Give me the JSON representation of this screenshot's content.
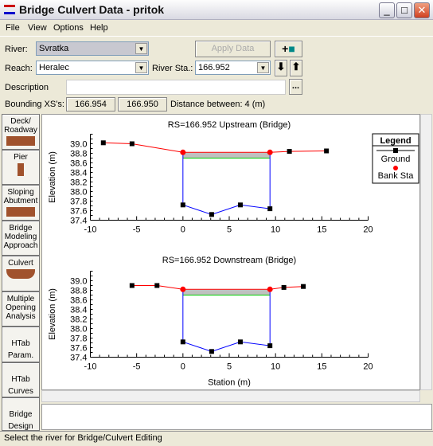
{
  "window": {
    "title": "Bridge Culvert Data - pritok",
    "icon": "bridge-icon"
  },
  "menu": [
    "File",
    "View",
    "Options",
    "Help"
  ],
  "form": {
    "river_label": "River:",
    "river_value": "Svratka",
    "reach_label": "Reach:",
    "reach_value": "Heralec",
    "river_sta_label": "River Sta.:",
    "river_sta_value": "166.952",
    "apply_label": "Apply Data",
    "description_label": "Description",
    "description_value": "",
    "more_label": "...",
    "bounding_label": "Bounding XS's:",
    "bounding_up": "166.954",
    "bounding_down": "166.950",
    "distance_text": "Distance between: 4 (m)"
  },
  "sidebar": [
    "Deck/\nRoadway",
    "Pier",
    "Sloping\nAbutment",
    "Bridge\nModeling\nApproach",
    "Culvert",
    "Multiple\nOpening\nAnalysis",
    "HTab\nParam.",
    "HTab\nCurves",
    "Bridge\nDesign"
  ],
  "status": "Select the river for Bridge/Culvert Editing",
  "legend": {
    "title": "Legend",
    "ground": "Ground",
    "bank": "Bank Sta"
  },
  "colors": {
    "ground_overbank": "#ff0000",
    "ground_channel": "#0000ff",
    "bank": "#ff0000",
    "deck": "#c0c0c0",
    "low_chord": "#00cc00"
  },
  "chart_data": [
    {
      "type": "line",
      "title": "RS=166.952 Upstream  (Bridge)",
      "xlabel": "",
      "ylabel": "Elevation (m)",
      "xlim": [
        -10,
        20
      ],
      "ylim": [
        37.4,
        39.2
      ],
      "xticks": [
        -10,
        -5,
        0,
        5,
        10,
        15,
        20
      ],
      "yticks": [
        37.4,
        37.6,
        37.8,
        38.0,
        38.2,
        38.4,
        38.6,
        38.8,
        39.0
      ],
      "ground_left": [
        [
          -8.6,
          39.02
        ],
        [
          -5.5,
          39.0
        ],
        [
          0,
          38.82
        ]
      ],
      "ground_right": [
        [
          9.4,
          38.82
        ],
        [
          11.5,
          38.84
        ],
        [
          15.5,
          38.85
        ]
      ],
      "channel": [
        [
          0,
          37.72
        ],
        [
          3.1,
          37.52
        ],
        [
          6.2,
          37.72
        ],
        [
          9.4,
          37.64
        ]
      ],
      "bank_stations": [
        [
          0,
          38.82
        ],
        [
          9.4,
          38.82
        ]
      ],
      "deck": {
        "x": [
          0,
          9.4
        ],
        "high_chord": 38.82,
        "low_chord": 38.7
      }
    },
    {
      "type": "line",
      "title": "RS=166.952 Downstream  (Bridge)",
      "xlabel": "Station (m)",
      "ylabel": "Elevation (m)",
      "xlim": [
        -10,
        20
      ],
      "ylim": [
        37.4,
        39.2
      ],
      "xticks": [
        -10,
        -5,
        0,
        5,
        10,
        15,
        20
      ],
      "yticks": [
        37.4,
        37.6,
        37.8,
        38.0,
        38.2,
        38.4,
        38.6,
        38.8,
        39.0
      ],
      "ground_left": [
        [
          -5.5,
          38.9
        ],
        [
          -2.8,
          38.9
        ],
        [
          0,
          38.82
        ]
      ],
      "ground_right": [
        [
          9.4,
          38.82
        ],
        [
          10.9,
          38.86
        ],
        [
          13,
          38.88
        ]
      ],
      "channel": [
        [
          0,
          37.72
        ],
        [
          3.1,
          37.52
        ],
        [
          6.2,
          37.72
        ],
        [
          9.4,
          37.64
        ]
      ],
      "bank_stations": [
        [
          0,
          38.82
        ],
        [
          9.4,
          38.82
        ]
      ],
      "deck": {
        "x": [
          0,
          9.4
        ],
        "high_chord": 38.82,
        "low_chord": 38.7
      }
    }
  ]
}
